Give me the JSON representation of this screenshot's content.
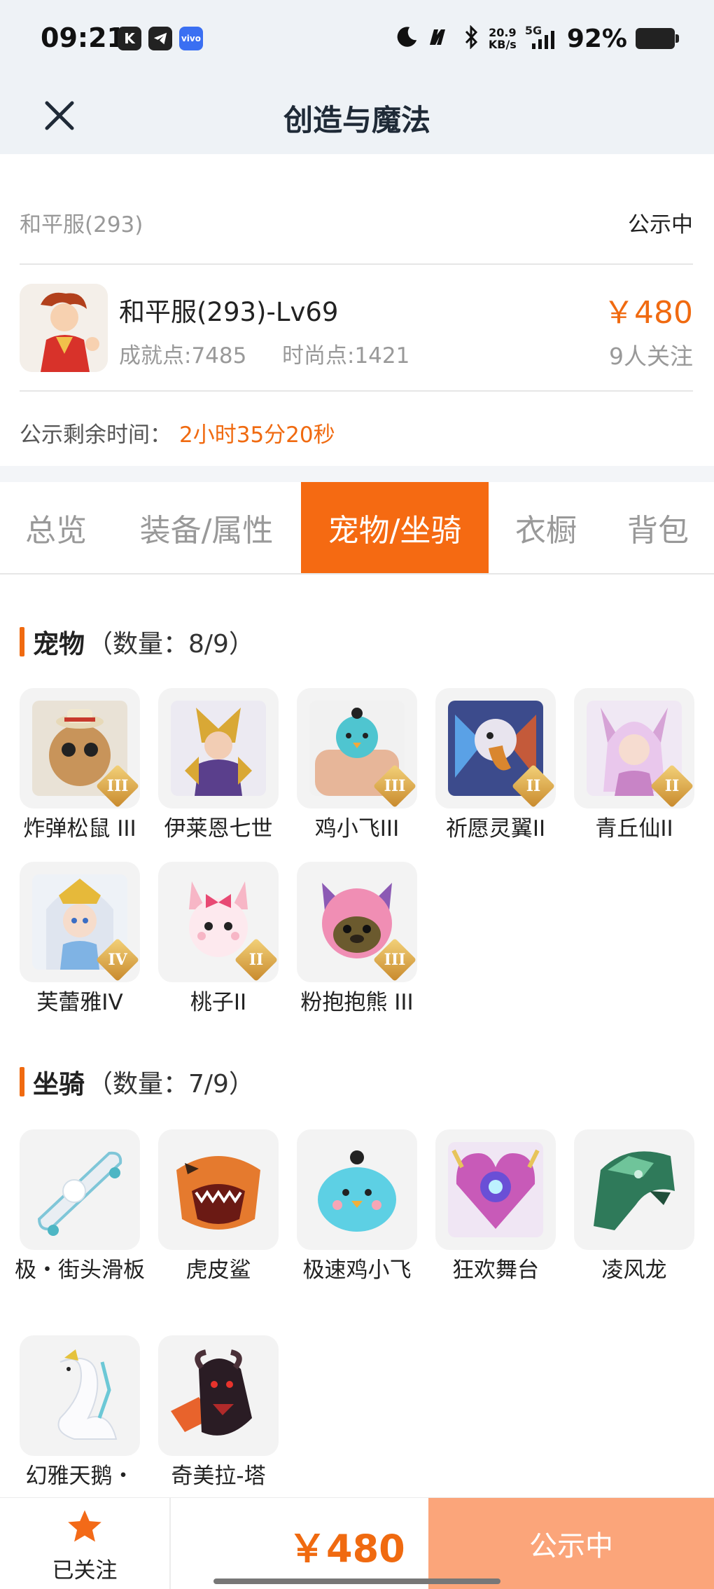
{
  "status_bar": {
    "time": "09:21",
    "net_speed_value": "20.9",
    "net_speed_unit": "KB/s",
    "network": "5G",
    "battery": "92%"
  },
  "header": {
    "title": "创造与魔法",
    "close_icon": "close-icon"
  },
  "info": {
    "server": "和平服(293)",
    "status": "公示中",
    "char_name": "和平服(293)-Lv69",
    "achievement": "成就点:7485",
    "fashion": "时尚点:1421",
    "price": "￥480",
    "watchers": "9人关注",
    "remain_label": "公示剩余时间：",
    "remain_value": "2小时35分20秒"
  },
  "tabs": [
    {
      "label": "总览",
      "active": false
    },
    {
      "label": "装备/属性",
      "active": false
    },
    {
      "label": "宠物/坐骑",
      "active": true
    },
    {
      "label": "衣橱",
      "active": false
    },
    {
      "label": "背包",
      "active": false
    }
  ],
  "pets": {
    "title": "宠物",
    "count": "（数量：8/9）",
    "items": [
      {
        "name": "炸弹松鼠 III",
        "tier": "III"
      },
      {
        "name": "伊莱恩七世",
        "tier": ""
      },
      {
        "name": "鸡小飞III",
        "tier": "III"
      },
      {
        "name": "祈愿灵翼II",
        "tier": "II"
      },
      {
        "name": "青丘仙II",
        "tier": "II"
      },
      {
        "name": "芙蕾雅IV",
        "tier": "IV"
      },
      {
        "name": "桃子II",
        "tier": "II"
      },
      {
        "name": "粉抱抱熊 III",
        "tier": "III"
      }
    ]
  },
  "mounts": {
    "title": "坐骑",
    "count": "（数量：7/9）",
    "items": [
      {
        "name": "极・街头滑板"
      },
      {
        "name": "虎皮鲨"
      },
      {
        "name": "极速鸡小飞"
      },
      {
        "name": "狂欢舞台"
      },
      {
        "name": "凌风龙"
      },
      {
        "name": "幻雅天鹅・"
      },
      {
        "name": "奇美拉-塔"
      }
    ]
  },
  "bottom": {
    "follow_label": "已关注",
    "price": "￥480",
    "status_button": "公示中"
  },
  "colors": {
    "accent": "#f06a10",
    "tab_active": "#f56a12",
    "status_button": "#fba57a"
  }
}
